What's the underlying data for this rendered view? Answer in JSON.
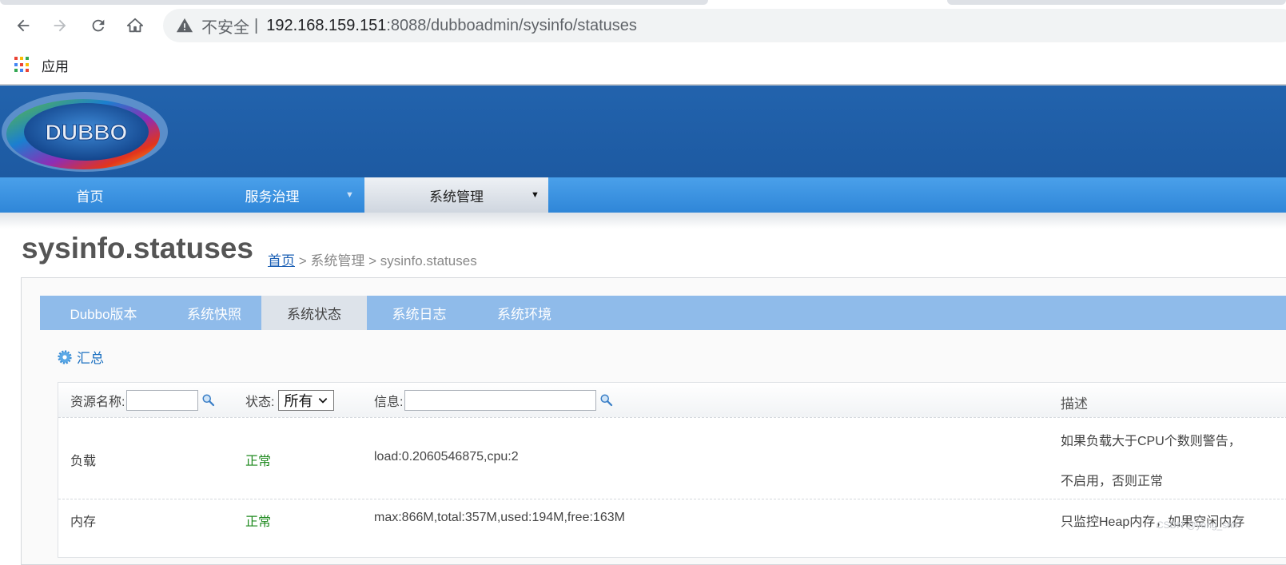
{
  "browser": {
    "insecure_label": "不安全",
    "url_host": "192.168.159.151",
    "url_path": ":8088/dubboadmin/sysinfo/statuses",
    "bookmark_apps": "应用"
  },
  "logo": {
    "text": "DUBBO"
  },
  "mainnav": {
    "home": "首页",
    "governance": "服务治理",
    "sysadmin": "系统管理"
  },
  "page": {
    "title": "sysinfo.statuses",
    "breadcrumb_home": "首页",
    "breadcrumb_rest": " > 系统管理 > sysinfo.statuses"
  },
  "subtabs": [
    "Dubbo版本",
    "系统快照",
    "系统状态",
    "系统日志",
    "系统环境"
  ],
  "summary_label": "汇总",
  "table": {
    "filter_resource_label": "资源名称:",
    "filter_status_label": "状态:",
    "filter_status_value": "所有",
    "filter_info_label": "信息:",
    "desc_header": "描述",
    "rows": [
      {
        "resource": "负载",
        "status": "正常",
        "info": "load:0.2060546875,cpu:2",
        "desc_line1": "如果负载大于CPU个数则警告，",
        "desc_line2": "不启用，否则正常"
      },
      {
        "resource": "内存",
        "status": "正常",
        "info": "max:866M,total:357M,used:194M,free:163M",
        "desc_line1": "只监控Heap内存，如果空闲内存"
      }
    ]
  },
  "watermark": "CSDN @yong_shh"
}
